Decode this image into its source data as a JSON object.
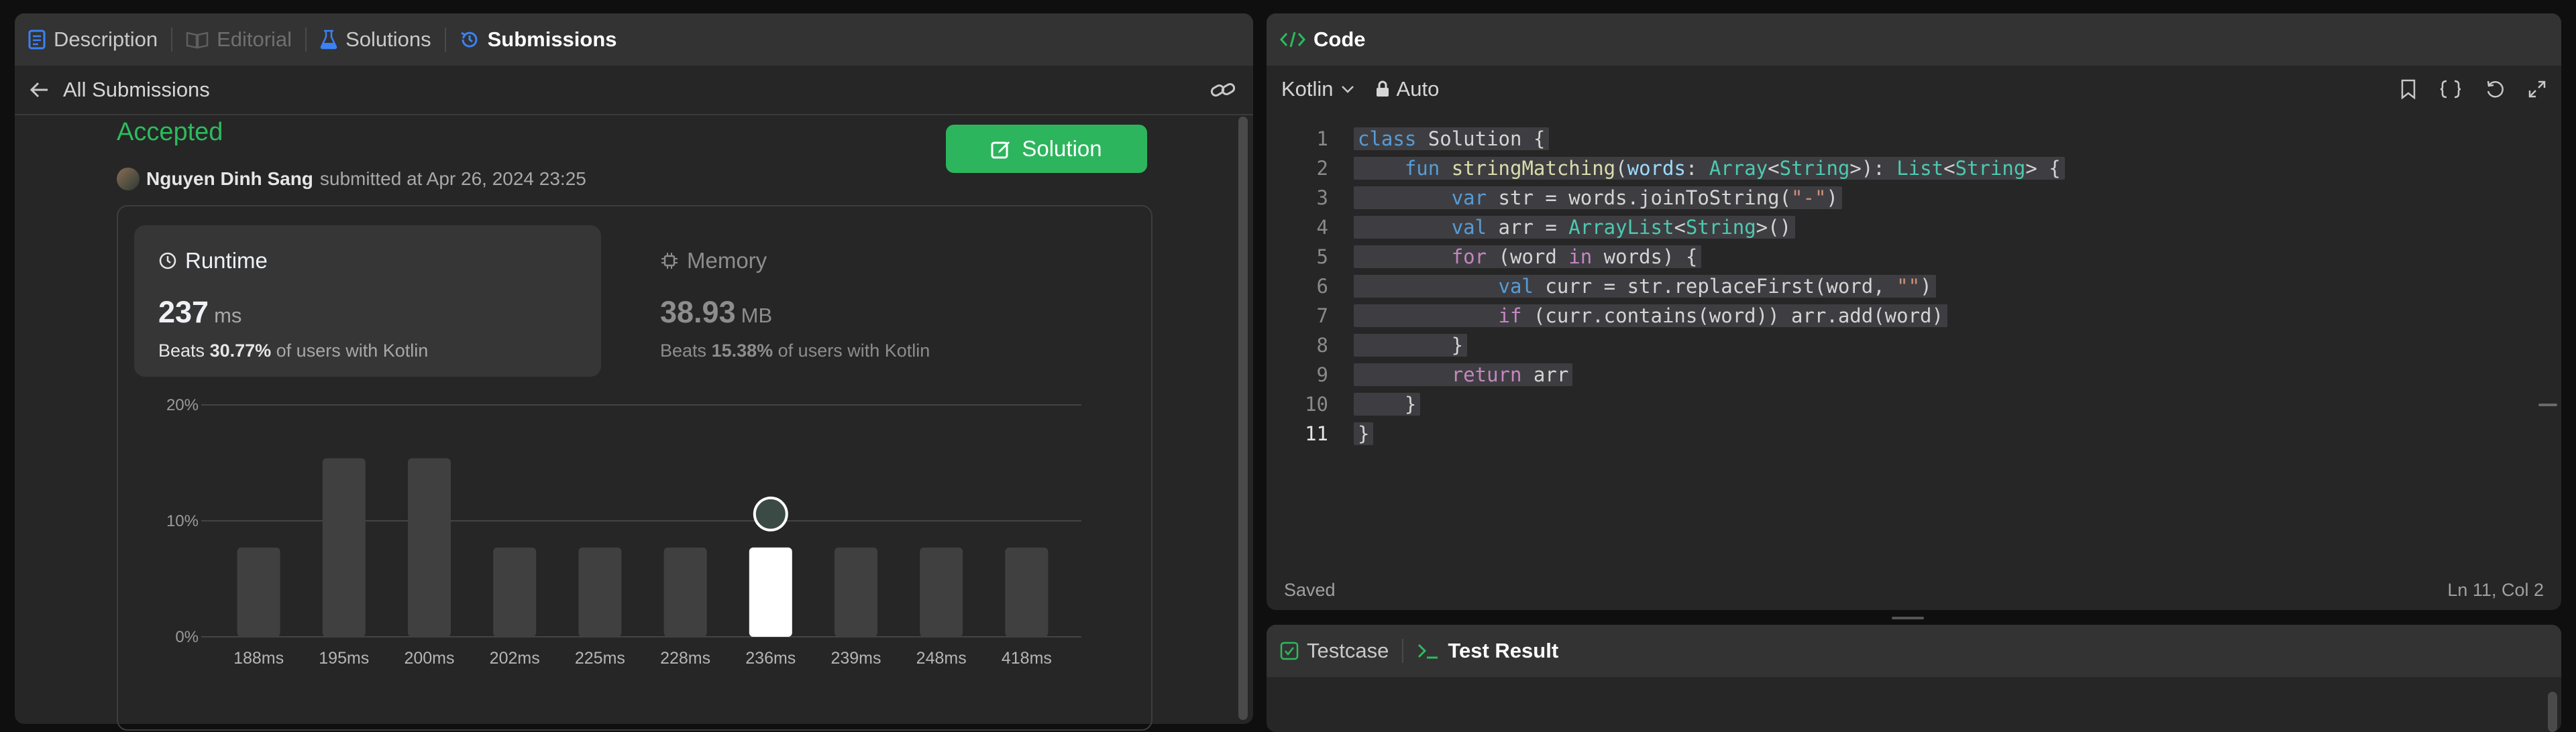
{
  "left_tabs": [
    {
      "label": "Description",
      "icon": "description-icon"
    },
    {
      "label": "Editorial",
      "icon": "book-icon"
    },
    {
      "label": "Solutions",
      "icon": "flask-icon"
    },
    {
      "label": "Submissions",
      "icon": "history-icon"
    }
  ],
  "subbar": {
    "back_label": "All Submissions"
  },
  "submission": {
    "status": "Accepted",
    "user": "Nguyen Dinh Sang",
    "submitted_text": "submitted at Apr 26, 2024 23:25",
    "solution_button": "Solution"
  },
  "runtime": {
    "title": "Runtime",
    "value": "237",
    "unit": "ms",
    "beats_prefix": "Beats",
    "beats_pct": "30.77%",
    "beats_suffix": "of users with Kotlin"
  },
  "memory": {
    "title": "Memory",
    "value": "38.93",
    "unit": "MB",
    "beats_prefix": "Beats",
    "beats_pct": "15.38%",
    "beats_suffix": "of users with Kotlin"
  },
  "chart_data": {
    "type": "bar",
    "categories": [
      "188ms",
      "195ms",
      "200ms",
      "202ms",
      "225ms",
      "228ms",
      "236ms",
      "239ms",
      "248ms",
      "418ms"
    ],
    "values": [
      7.7,
      15.4,
      15.4,
      7.7,
      7.7,
      7.7,
      7.7,
      7.7,
      7.7,
      7.7
    ],
    "highlight_index": 6,
    "yticks": [
      "20%",
      "10%",
      "0%"
    ],
    "ylim": [
      0,
      20
    ],
    "grid": true,
    "colors": {
      "bar": "#404040",
      "highlight": "#ffffff",
      "grid": "#444444"
    }
  },
  "code_panel": {
    "title": "Code",
    "language": "Kotlin",
    "mode": "Auto",
    "status": "Saved",
    "cursor": "Ln 11, Col 2",
    "lines": [
      {
        "n": "1",
        "tokens": [
          {
            "t": "class",
            "c": "kw2"
          },
          {
            "t": " Solution {",
            "c": "ty-name"
          }
        ]
      },
      {
        "n": "2",
        "tokens": [
          {
            "t": "    "
          },
          {
            "t": "fun",
            "c": "kw2"
          },
          {
            "t": " "
          },
          {
            "t": "stringMatching",
            "c": "fn"
          },
          {
            "t": "("
          },
          {
            "t": "words",
            "c": "vr"
          },
          {
            "t": ": "
          },
          {
            "t": "Array",
            "c": "ty"
          },
          {
            "t": "<"
          },
          {
            "t": "String",
            "c": "ty"
          },
          {
            "t": ">): "
          },
          {
            "t": "List",
            "c": "ty"
          },
          {
            "t": "<"
          },
          {
            "t": "String",
            "c": "ty"
          },
          {
            "t": "> {"
          }
        ]
      },
      {
        "n": "3",
        "tokens": [
          {
            "t": "        "
          },
          {
            "t": "var",
            "c": "kw2"
          },
          {
            "t": " str = words.joinToString("
          },
          {
            "t": "\"-\"",
            "c": "st"
          },
          {
            "t": ")"
          }
        ]
      },
      {
        "n": "4",
        "tokens": [
          {
            "t": "        "
          },
          {
            "t": "val",
            "c": "kw2"
          },
          {
            "t": " arr = "
          },
          {
            "t": "ArrayList",
            "c": "ty"
          },
          {
            "t": "<"
          },
          {
            "t": "String",
            "c": "ty"
          },
          {
            "t": ">()"
          }
        ]
      },
      {
        "n": "5",
        "tokens": [
          {
            "t": "        "
          },
          {
            "t": "for",
            "c": "kw"
          },
          {
            "t": " (word "
          },
          {
            "t": "in",
            "c": "kw"
          },
          {
            "t": " words) {"
          }
        ]
      },
      {
        "n": "6",
        "tokens": [
          {
            "t": "            "
          },
          {
            "t": "val",
            "c": "kw2"
          },
          {
            "t": " curr = str.replaceFirst(word, "
          },
          {
            "t": "\"\"",
            "c": "st"
          },
          {
            "t": ")"
          }
        ]
      },
      {
        "n": "7",
        "tokens": [
          {
            "t": "            "
          },
          {
            "t": "if",
            "c": "kw"
          },
          {
            "t": " (curr.contains(word)) arr.add(word)"
          }
        ]
      },
      {
        "n": "8",
        "tokens": [
          {
            "t": "        }"
          }
        ]
      },
      {
        "n": "9",
        "tokens": [
          {
            "t": "        "
          },
          {
            "t": "return",
            "c": "kw"
          },
          {
            "t": " arr"
          }
        ]
      },
      {
        "n": "10",
        "tokens": [
          {
            "t": "    }"
          }
        ]
      },
      {
        "n": "11",
        "tokens": [
          {
            "t": "}"
          }
        ]
      }
    ]
  },
  "test_tabs": [
    {
      "label": "Testcase",
      "icon": "check-square-icon"
    },
    {
      "label": "Test Result",
      "icon": "terminal-icon"
    }
  ]
}
